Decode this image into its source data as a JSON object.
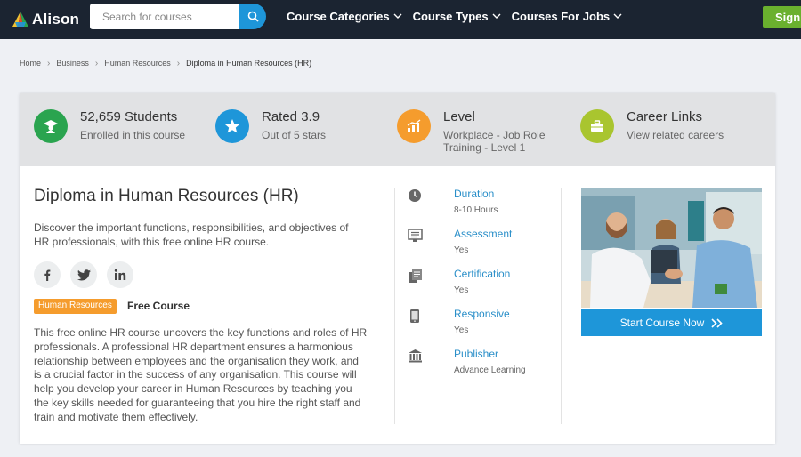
{
  "navbar": {
    "logo_text": "Alison",
    "search_placeholder": "Search for courses",
    "links": [
      {
        "label": "Course Categories"
      },
      {
        "label": "Course Types"
      },
      {
        "label": "Courses For Jobs"
      }
    ],
    "signup_label": "Sign"
  },
  "breadcrumb": {
    "items": [
      "Home",
      "Business",
      "Human Resources"
    ],
    "current": "Diploma in Human Resources (HR)"
  },
  "stats": [
    {
      "title": "52,659 Students",
      "sub": "Enrolled in this course",
      "icon": "graduate-icon",
      "color": "#2aa44f"
    },
    {
      "title": "Rated 3.9",
      "sub": "Out of 5 stars",
      "icon": "star-icon",
      "color": "#1e96d9"
    },
    {
      "title": "Level",
      "sub": "Workplace - Job Role Training - Level 1",
      "icon": "bar-chart-icon",
      "color": "#f59c2d"
    },
    {
      "title": "Career Links",
      "sub": "View related careers",
      "icon": "briefcase-icon",
      "color": "#a9c52f"
    }
  ],
  "course": {
    "title": "Diploma in Human Resources (HR)",
    "description": "Discover the important functions, responsibilities, and objectives of HR professionals, with this free online HR course.",
    "tag": "Human Resources",
    "price_type": "Free Course",
    "body": "This free online HR course uncovers the key functions and roles of HR professionals. A professional HR department ensures a harmonious relationship between employees and the organisation they work, and is a crucial factor in the success of any organisation. This course will help you develop your career in Human Resources by teaching you the key skills needed for guaranteeing that you hire the right staff and train and motivate them effectively."
  },
  "social": [
    {
      "glyph": "f",
      "icon": "facebook-icon"
    },
    {
      "glyph": "twitter",
      "icon": "twitter-icon"
    },
    {
      "glyph": "in",
      "icon": "linkedin-icon"
    }
  ],
  "details": [
    {
      "label": "Duration",
      "value": "8-10 Hours",
      "icon": "clock-icon"
    },
    {
      "label": "Assessment",
      "value": "Yes",
      "icon": "assessment-icon"
    },
    {
      "label": "Certification",
      "value": "Yes",
      "icon": "certificate-icon"
    },
    {
      "label": "Responsive",
      "value": "Yes",
      "icon": "mobile-icon"
    },
    {
      "label": "Publisher",
      "value": "Advance Learning",
      "icon": "bank-icon"
    }
  ],
  "cta": {
    "label": "Start Course Now"
  },
  "colors": {
    "nav_bg": "#1b2431",
    "accent_blue": "#1e96d9",
    "accent_green": "#6ab02e",
    "tag_orange": "#f59c2d",
    "stats_bg": "#e1e2e4"
  }
}
